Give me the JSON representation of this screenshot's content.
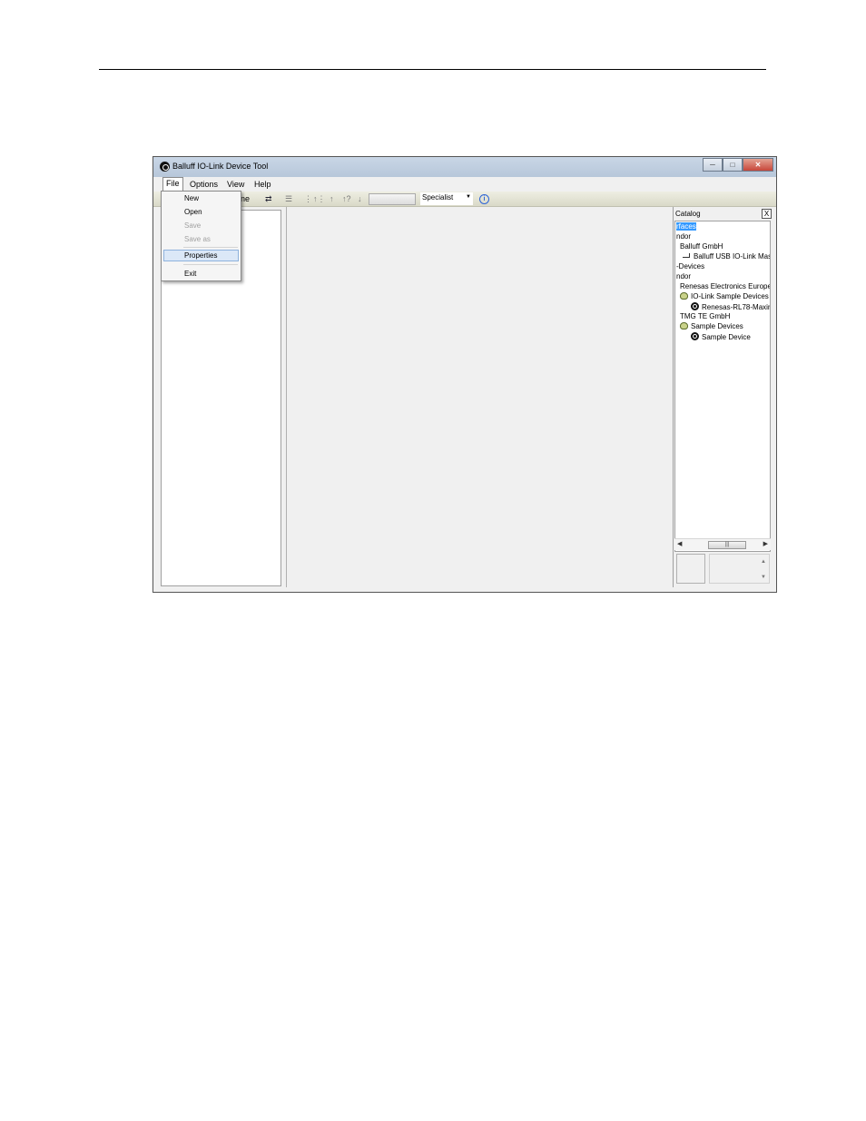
{
  "window": {
    "title": "Balluff IO-Link Device Tool"
  },
  "menubar": {
    "file": "File",
    "options": "Options",
    "view": "View",
    "help": "Help"
  },
  "file_menu": {
    "new": "New",
    "open": "Open",
    "save": "Save",
    "save_as": "Save as",
    "properties": "Properties",
    "exit": "Exit"
  },
  "toolbar": {
    "partial_label": "ne",
    "user_role": "Specialist"
  },
  "catalog": {
    "title": "Catalog",
    "close_label": "X",
    "items": [
      {
        "label": "rfaces",
        "selected": true
      },
      {
        "label": "ndor"
      },
      {
        "label": "Balluff GmbH"
      },
      {
        "label": "Balluff USB IO-Link Master",
        "icon": "usb-master-icon"
      },
      {
        "label": "-Devices"
      },
      {
        "label": "ndor"
      },
      {
        "label": "Renesas Electronics Europe G"
      },
      {
        "label": "IO-Link Sample Devices",
        "icon": "folder-icon"
      },
      {
        "label": "Renesas-RL78-Maxim",
        "icon": "device-icon"
      },
      {
        "label": "TMG TE GmbH"
      },
      {
        "label": "Sample Devices",
        "icon": "folder-icon"
      },
      {
        "label": "Sample Device",
        "icon": "device-icon"
      }
    ]
  },
  "colors": {
    "selection": "#3399ff",
    "menu_highlight": "#dbe8f7",
    "titlebar": "#b7c7da"
  }
}
